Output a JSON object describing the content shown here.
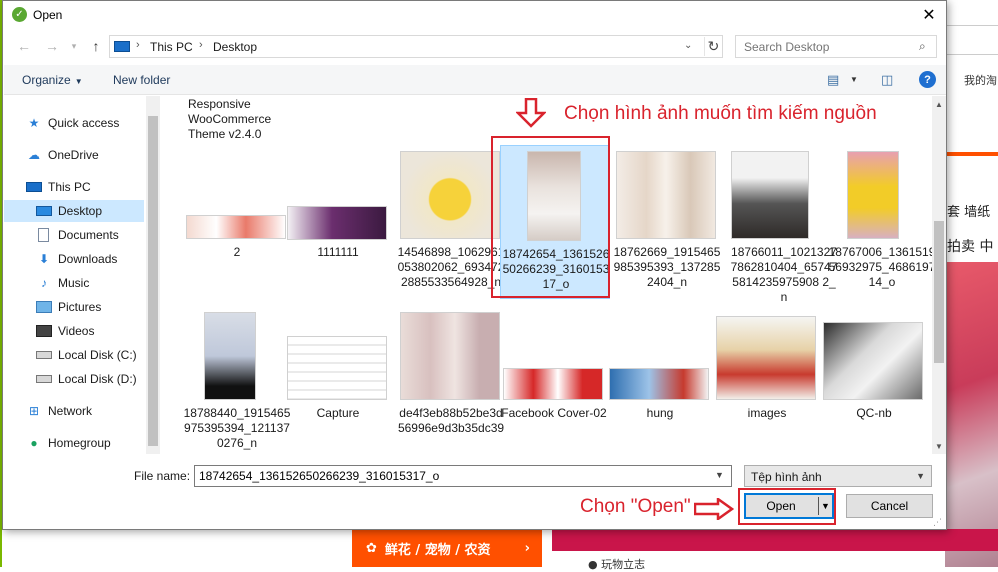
{
  "dialog": {
    "title": "Open",
    "close_glyph": "✕"
  },
  "address": {
    "crumbs": [
      "This PC",
      "Desktop"
    ],
    "search_placeholder": "Search Desktop"
  },
  "toolbar": {
    "organize": "Organize",
    "new_folder": "New folder",
    "help": "?"
  },
  "nav": {
    "items": [
      {
        "label": "Quick access",
        "icon": "star-icon"
      },
      {
        "label": "OneDrive",
        "icon": "cloud-icon"
      },
      {
        "label": "This PC",
        "icon": "computer-icon"
      },
      {
        "label": "Desktop",
        "icon": "desktop-icon",
        "selected": true
      },
      {
        "label": "Documents",
        "icon": "document-icon"
      },
      {
        "label": "Downloads",
        "icon": "download-icon"
      },
      {
        "label": "Music",
        "icon": "music-icon"
      },
      {
        "label": "Pictures",
        "icon": "pictures-icon"
      },
      {
        "label": "Videos",
        "icon": "video-icon"
      },
      {
        "label": "Local Disk (C:)",
        "icon": "drive-icon"
      },
      {
        "label": "Local Disk (D:)",
        "icon": "drive-icon"
      },
      {
        "label": "Network",
        "icon": "network-icon"
      },
      {
        "label": "Homegroup",
        "icon": "homegroup-icon"
      }
    ]
  },
  "files": {
    "top_partial": "Responsive\nWooCommerce\nTheme v2.4.0",
    "row1": [
      "2",
      "1111111",
      "14546898_1062961053802062_6934722885533564928_n",
      "18742654_136152650266239_316015317_o",
      "18762669_1915465985395393_1372852404_n",
      "18766011_1021327786281040​4_657475814235975908 2_n",
      "18767006_136151956932975_468619714_o"
    ],
    "row2": [
      "18788440_1915465975395394_1211370276_n",
      "Capture",
      "de4f3eb88b52be3d56996e9d3b35dc39",
      "Facebook Cover-02",
      "hung",
      "images",
      "QC-nb"
    ]
  },
  "bottom": {
    "file_name_label": "File name:",
    "file_name_value": "18742654_136152650266239_316015317_o",
    "file_type": "Tệp hình ảnh",
    "open": "Open",
    "cancel": "Cancel"
  },
  "annotations": {
    "choose_image": "Chọn hình ảnh muốn tìm kiếm nguồn",
    "choose_open": "Chọn \"Open\""
  },
  "background": {
    "snippet_1": "我的淘",
    "snippet_2": "套 墙纸",
    "snippet_3": "拍卖 中",
    "category": "鲜花 / 宠物 / 农资",
    "bottom_snippet": "● 玩物立志"
  },
  "colors": {
    "selection": "#cce8ff",
    "accent_blue": "#0078d7",
    "annotation_red": "#d9232d",
    "page_orange": "#ff5000"
  }
}
